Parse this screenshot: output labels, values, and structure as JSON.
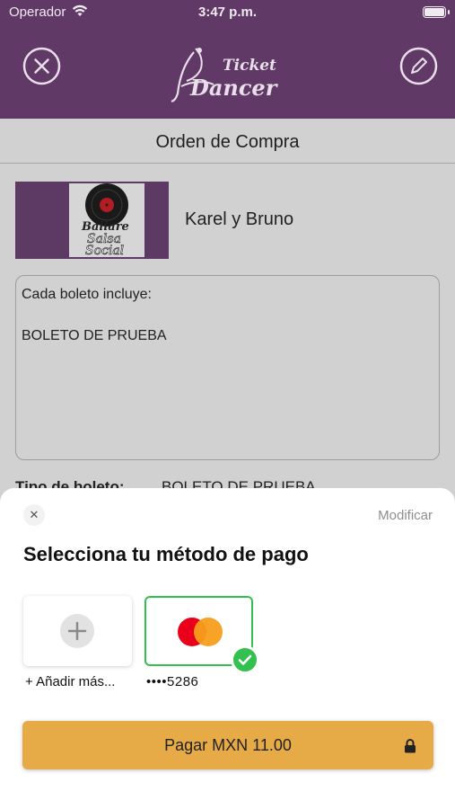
{
  "status_bar": {
    "carrier": "Operador",
    "time": "3:47 p.m."
  },
  "header": {
    "logo_text_top": "Ticket",
    "logo_text_bottom": "Dancer"
  },
  "order": {
    "title": "Orden de Compra",
    "event_name": "Karel y Bruno",
    "event_image_text": [
      "Ballare",
      "Salsa",
      "Social"
    ],
    "includes_label": "Cada boleto incluye:",
    "includes_item": "BOLETO DE PRUEBA",
    "ticket_type_label": "Tipo de boleto:",
    "ticket_type_value": "BOLETO DE PRUEBA"
  },
  "payment_sheet": {
    "close_label": "✕",
    "modify_label": "Modificar",
    "title": "Selecciona tu método de pago",
    "add_more_label": "+ Añadir más...",
    "card_label": "••••5286",
    "pay_button_label": "Pagar MXN 11.00"
  },
  "colors": {
    "header_purple": "#603966",
    "pay_button": "#e6ab47",
    "selected_green": "#34c04f"
  }
}
